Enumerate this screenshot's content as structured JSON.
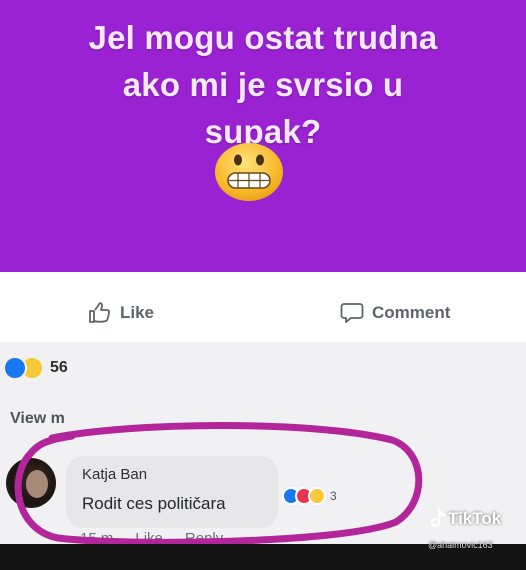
{
  "post": {
    "lines": [
      "Jel mogu ostat trudna",
      "ako mi je svrsio u",
      "supak?"
    ],
    "emoji": "grimacing-face",
    "background_color": "#9a22d2"
  },
  "actions": {
    "like_label": "Like",
    "comment_label": "Comment"
  },
  "reactions": {
    "types": [
      "like",
      "haha"
    ],
    "count": "56"
  },
  "view_more": "View m",
  "comment": {
    "author": "Katja Ban",
    "text": "Rodit ces političara",
    "reactions": [
      "like",
      "love",
      "haha"
    ],
    "reaction_count": "3",
    "time": "15 m",
    "like_label": "Like",
    "reply_label": "Reply"
  },
  "watermark": {
    "brand": "TikTok",
    "username": "@ahaimovic163"
  },
  "colors": {
    "highlight": "#b3269b",
    "facebook_blue": "#1877f2"
  }
}
